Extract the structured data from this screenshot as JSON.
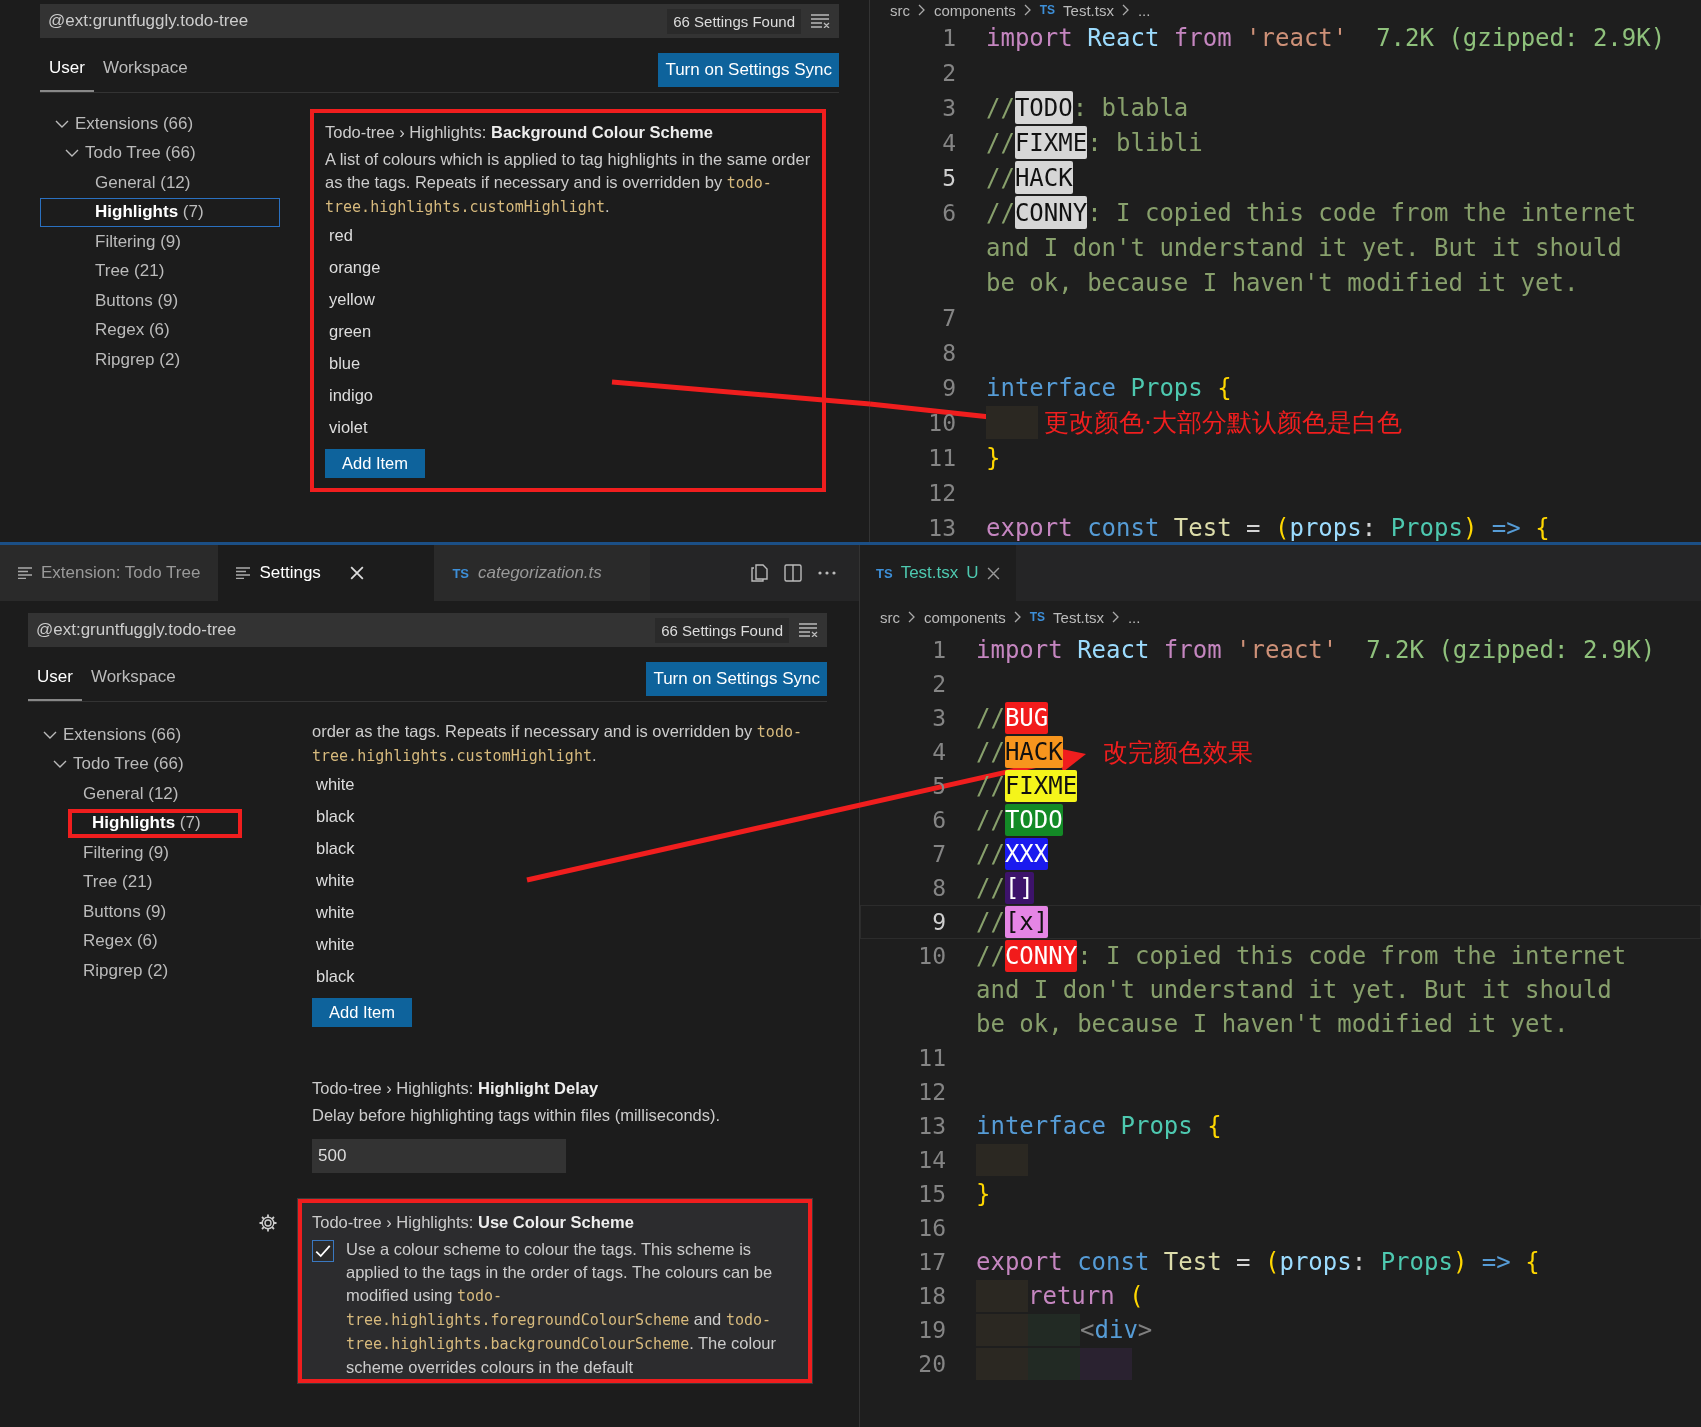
{
  "top": {
    "settings": {
      "search": {
        "value": "@ext:gruntfuggly.todo-tree",
        "count": "66 Settings Found"
      },
      "scope_tabs": [
        {
          "label": "User",
          "selected": true
        },
        {
          "label": "Workspace",
          "selected": false
        }
      ],
      "sync_button": "Turn on Settings Sync",
      "tree_focused": true,
      "tree": [
        {
          "label": "Extensions",
          "count": "(66)",
          "expanded": true,
          "children": [
            {
              "label": "Todo Tree",
              "count": "(66)",
              "expanded": true,
              "children": [
                {
                  "label": "General",
                  "count": "(12)",
                  "selected": false,
                  "annotated": false
                },
                {
                  "label": "Highlights",
                  "count": "(7)",
                  "selected": true,
                  "annotated": false
                },
                {
                  "label": "Filtering",
                  "count": "(9)",
                  "selected": false,
                  "annotated": false
                },
                {
                  "label": "Tree",
                  "count": "(21)",
                  "selected": false,
                  "annotated": false
                },
                {
                  "label": "Buttons",
                  "count": "(9)",
                  "selected": false,
                  "annotated": false
                },
                {
                  "label": "Regex",
                  "count": "(6)",
                  "selected": false,
                  "annotated": false
                },
                {
                  "label": "Ripgrep",
                  "count": "(2)",
                  "selected": false,
                  "annotated": false
                }
              ]
            }
          ]
        }
      ],
      "settings": [
        {
          "kind": "list",
          "title": "Todo-tree › Highlights: **Background Colour Scheme**",
          "annotated": true,
          "hovered": false,
          "description": [
            {
              "kind": "text",
              "text": "A list of colours which is applied to tag highlights in the same order as the tags. Repeats if necessary and is overridden by "
            },
            {
              "kind": "code",
              "text": "todo-tree.highlights.customHighlight"
            },
            {
              "kind": "text",
              "text": "."
            }
          ],
          "items": [
            "red",
            "orange",
            "yellow",
            "green",
            "blue",
            "indigo",
            "violet"
          ],
          "add_button": "Add Item"
        }
      ]
    },
    "editor": {
      "breadcrumbs": [
        {
          "label": "src"
        },
        {
          "label": "components"
        },
        {
          "label": "Test.tsx",
          "file_icon": "TS"
        },
        {
          "label": "..."
        }
      ],
      "lines": [
        {
          "number": "1",
          "current": false,
          "tokens": [
            {
              "kind": "kw",
              "text": "import "
            },
            {
              "kind": "var",
              "text": "React "
            },
            {
              "kind": "kw",
              "text": "from "
            },
            {
              "kind": "str",
              "text": "'react'"
            },
            {
              "kind": "info",
              "text": "  7.2K (gzipped: 2.9K)"
            }
          ]
        },
        {
          "number": "2",
          "current": false
        },
        {
          "number": "3",
          "current": false,
          "tokens": [
            {
              "kind": "com",
              "text": "//"
            },
            {
              "kind": "tag",
              "text": "TODO",
              "color": "#d6d6d6",
              "dark_text": true
            },
            {
              "kind": "com",
              "text": ": blabla"
            }
          ]
        },
        {
          "number": "4",
          "current": false,
          "tokens": [
            {
              "kind": "com",
              "text": "//"
            },
            {
              "kind": "tag",
              "text": "FIXME",
              "color": "#d6d6d6",
              "dark_text": true
            },
            {
              "kind": "com",
              "text": ": blibli"
            }
          ]
        },
        {
          "number": "5",
          "current": true,
          "tokens": [
            {
              "kind": "com",
              "text": "//"
            },
            {
              "kind": "tag",
              "text": "HACK",
              "color": "#d6d6d6",
              "dark_text": true
            }
          ]
        },
        {
          "number": "6",
          "current": false,
          "tokens": [
            {
              "kind": "com",
              "text": "//"
            },
            {
              "kind": "tag",
              "text": "CONNY",
              "color": "#d6d6d6",
              "dark_text": true
            },
            {
              "kind": "com",
              "text": ": I copied this code from the internet"
            }
          ]
        },
        {
          "tokens": [
            {
              "kind": "com",
              "text": "and I don't understand it yet. But it should"
            }
          ]
        },
        {
          "tokens": [
            {
              "kind": "com",
              "text": "be ok, because I haven't modified it yet."
            }
          ]
        },
        {
          "number": "7",
          "current": false
        },
        {
          "number": "8",
          "current": false
        },
        {
          "number": "9",
          "current": false,
          "tokens": [
            {
              "kind": "kw2",
              "text": "interface "
            },
            {
              "kind": "type",
              "text": "Props "
            },
            {
              "kind": "brace",
              "text": "{"
            }
          ]
        },
        {
          "number": "10",
          "current": false,
          "tokens": [
            {
              "kind": "indent",
              "color": "#2b2822"
            }
          ],
          "note": "更改颜色·大部分默认颜色是白色"
        },
        {
          "number": "11",
          "current": false,
          "tokens": [
            {
              "kind": "brace",
              "text": "}"
            }
          ]
        },
        {
          "number": "12",
          "current": false
        },
        {
          "number": "13",
          "current": false,
          "tokens": [
            {
              "kind": "kw",
              "text": "export "
            },
            {
              "kind": "kw2",
              "text": "const "
            },
            {
              "kind": "fn",
              "text": "Test"
            },
            {
              "kind": "plain",
              "text": " = "
            },
            {
              "kind": "brace",
              "text": "("
            },
            {
              "kind": "var",
              "text": "props"
            },
            {
              "kind": "plain",
              "text": ": "
            },
            {
              "kind": "type",
              "text": "Props"
            },
            {
              "kind": "brace",
              "text": ")"
            },
            {
              "kind": "kw2",
              "text": " => "
            },
            {
              "kind": "brace",
              "text": "{"
            }
          ]
        }
      ]
    }
  },
  "bottom": {
    "settings_tabs": [
      {
        "kind": "settings",
        "label": "Extension: Todo Tree",
        "selected": false,
        "preview": false,
        "closable": false
      },
      {
        "kind": "settings",
        "label": "Settings",
        "selected": true,
        "preview": false,
        "closable": true
      },
      {
        "kind": "file",
        "file_icon": "TS",
        "label": "categorization.ts",
        "selected": false,
        "preview": true,
        "closable": false
      }
    ],
    "settings": {
      "search": {
        "value": "@ext:gruntfuggly.todo-tree",
        "count": "66 Settings Found"
      },
      "scope_tabs": [
        {
          "label": "User",
          "selected": true
        },
        {
          "label": "Workspace",
          "selected": false
        }
      ],
      "sync_button": "Turn on Settings Sync",
      "tree_focused": false,
      "tree": [
        {
          "label": "Extensions",
          "count": "(66)",
          "expanded": true,
          "children": [
            {
              "label": "Todo Tree",
              "count": "(66)",
              "expanded": true,
              "children": [
                {
                  "label": "General",
                  "count": "(12)",
                  "selected": false,
                  "annotated": false
                },
                {
                  "label": "Highlights",
                  "count": "(7)",
                  "selected": true,
                  "annotated": true
                },
                {
                  "label": "Filtering",
                  "count": "(9)",
                  "selected": false,
                  "annotated": false
                },
                {
                  "label": "Tree",
                  "count": "(21)",
                  "selected": false,
                  "annotated": false
                },
                {
                  "label": "Buttons",
                  "count": "(9)",
                  "selected": false,
                  "annotated": false
                },
                {
                  "label": "Regex",
                  "count": "(6)",
                  "selected": false,
                  "annotated": false
                },
                {
                  "label": "Ripgrep",
                  "count": "(2)",
                  "selected": false,
                  "annotated": false
                }
              ]
            }
          ]
        }
      ],
      "settings": [
        {
          "kind": "list",
          "annotated": false,
          "hovered": false,
          "description": [
            {
              "kind": "text",
              "text": "order as the tags. Repeats if necessary and is overridden by "
            },
            {
              "kind": "code",
              "text": "todo-tree.highlights.customHighlight"
            },
            {
              "kind": "text",
              "text": "."
            }
          ],
          "items": [
            "white",
            "black",
            "black",
            "white",
            "white",
            "white",
            "black"
          ],
          "add_button": "Add Item"
        },
        {
          "kind": "number",
          "title": "Todo-tree › Highlights: **Highlight Delay**",
          "annotated": false,
          "hovered": false,
          "description": [
            {
              "kind": "text",
              "text": "Delay before highlighting tags within files (milliseconds)."
            }
          ],
          "value": "500"
        },
        {
          "kind": "checkbox",
          "title": "Todo-tree › Highlights: **Use Colour Scheme**",
          "annotated": true,
          "hovered": true,
          "checked": true,
          "description": [
            {
              "kind": "text",
              "text": "Use a colour scheme to colour the tags. This scheme is applied to the tags in the order of tags. The colours can be modified using "
            },
            {
              "kind": "code",
              "text": "todo-tree.highlights.foregroundColourScheme"
            },
            {
              "kind": "text",
              "text": " and "
            },
            {
              "kind": "code",
              "text": "todo-tree.highlights.backgroundColourScheme"
            },
            {
              "kind": "text",
              "text": ". The colour scheme overrides colours in the default"
            }
          ]
        }
      ]
    },
    "editor": {
      "tabs": [
        {
          "file_icon": "TS",
          "label": "Test.tsx",
          "badge": "U",
          "selected": true
        }
      ],
      "breadcrumbs": [
        {
          "label": "src"
        },
        {
          "label": "components"
        },
        {
          "label": "Test.tsx",
          "file_icon": "TS"
        },
        {
          "label": "..."
        }
      ],
      "lines": [
        {
          "number": "1",
          "current": false,
          "tokens": [
            {
              "kind": "kw",
              "text": "import "
            },
            {
              "kind": "var",
              "text": "React "
            },
            {
              "kind": "kw",
              "text": "from "
            },
            {
              "kind": "str",
              "text": "'react'"
            },
            {
              "kind": "info",
              "text": "  7.2K (gzipped: 2.9K)"
            }
          ]
        },
        {
          "number": "2",
          "current": false
        },
        {
          "number": "3",
          "current": false,
          "tokens": [
            {
              "kind": "com",
              "text": "//"
            },
            {
              "kind": "tag",
              "text": "BUG",
              "color": "#f21b1b",
              "dark_text": false
            }
          ]
        },
        {
          "number": "4",
          "current": false,
          "tokens": [
            {
              "kind": "com",
              "text": "//"
            },
            {
              "kind": "tag",
              "text": "HACK",
              "color": "#f7951d",
              "dark_text": true
            }
          ],
          "note": "改完颜色效果"
        },
        {
          "number": "5",
          "current": false,
          "tokens": [
            {
              "kind": "com",
              "text": "//"
            },
            {
              "kind": "tag",
              "text": "FIXME",
              "color": "#f5f51a",
              "dark_text": true
            }
          ]
        },
        {
          "number": "6",
          "current": false,
          "tokens": [
            {
              "kind": "com",
              "text": "//"
            },
            {
              "kind": "tag",
              "text": "TODO",
              "color": "#138a26",
              "dark_text": false
            }
          ]
        },
        {
          "number": "7",
          "current": false,
          "tokens": [
            {
              "kind": "com",
              "text": "//"
            },
            {
              "kind": "tag",
              "text": "XXX",
              "color": "#1a1aef",
              "dark_text": false
            }
          ]
        },
        {
          "number": "8",
          "current": false,
          "tokens": [
            {
              "kind": "com",
              "text": "//"
            },
            {
              "kind": "tag",
              "text": "[]",
              "color": "#3d136b",
              "dark_text": false
            }
          ]
        },
        {
          "number": "9",
          "current": true,
          "tokens": [
            {
              "kind": "com",
              "text": "//"
            },
            {
              "kind": "tag",
              "text": "[x]",
              "color": "#e585e5",
              "dark_text": true
            }
          ]
        },
        {
          "number": "10",
          "current": false,
          "tokens": [
            {
              "kind": "com",
              "text": "//"
            },
            {
              "kind": "tag",
              "text": "CONNY",
              "color": "#f21b1b",
              "dark_text": false
            },
            {
              "kind": "com",
              "text": ": I copied this code from the internet"
            }
          ]
        },
        {
          "tokens": [
            {
              "kind": "com",
              "text": "and I don't understand it yet. But it should"
            }
          ]
        },
        {
          "tokens": [
            {
              "kind": "com",
              "text": "be ok, because I haven't modified it yet."
            }
          ]
        },
        {
          "number": "11",
          "current": false
        },
        {
          "number": "12",
          "current": false
        },
        {
          "number": "13",
          "current": false,
          "tokens": [
            {
              "kind": "kw2",
              "text": "interface "
            },
            {
              "kind": "type",
              "text": "Props "
            },
            {
              "kind": "brace",
              "text": "{"
            }
          ]
        },
        {
          "number": "14",
          "current": false,
          "tokens": [
            {
              "kind": "indent",
              "color": "#2b2822"
            }
          ]
        },
        {
          "number": "15",
          "current": false,
          "tokens": [
            {
              "kind": "brace",
              "text": "}"
            }
          ]
        },
        {
          "number": "16",
          "current": false
        },
        {
          "number": "17",
          "current": false,
          "tokens": [
            {
              "kind": "kw",
              "text": "export "
            },
            {
              "kind": "kw2",
              "text": "const "
            },
            {
              "kind": "fn",
              "text": "Test"
            },
            {
              "kind": "plain",
              "text": " = "
            },
            {
              "kind": "brace",
              "text": "("
            },
            {
              "kind": "var",
              "text": "props"
            },
            {
              "kind": "plain",
              "text": ": "
            },
            {
              "kind": "type",
              "text": "Props"
            },
            {
              "kind": "brace",
              "text": ")"
            },
            {
              "kind": "kw2",
              "text": " => "
            },
            {
              "kind": "brace",
              "text": "{"
            }
          ]
        },
        {
          "number": "18",
          "current": false,
          "tokens": [
            {
              "kind": "indent",
              "color": "#2b2822"
            },
            {
              "kind": "kw",
              "text": "return "
            },
            {
              "kind": "brace",
              "text": "("
            }
          ]
        },
        {
          "number": "19",
          "current": false,
          "tokens": [
            {
              "kind": "indent",
              "color": "#2b2822"
            },
            {
              "kind": "indent",
              "color": "#222a24"
            },
            {
              "kind": "angle",
              "text": "<"
            },
            {
              "kind": "kw2",
              "text": "div"
            },
            {
              "kind": "angle",
              "text": ">"
            }
          ]
        },
        {
          "number": "20",
          "current": false,
          "tokens": [
            {
              "kind": "indent",
              "color": "#2b2822"
            },
            {
              "kind": "indent",
              "color": "#222a24"
            },
            {
              "kind": "indent",
              "color": "#2a2230"
            }
          ]
        }
      ]
    }
  }
}
